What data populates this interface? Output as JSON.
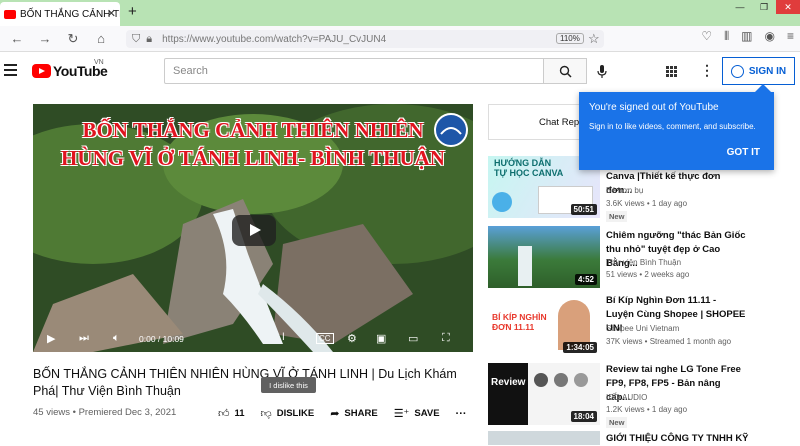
{
  "browser": {
    "tab_title": "BỐN THẮNG CẢNH THIÊN NHIÊN HÙNG VĨ Ở TÁNH LINH",
    "url": "https://www.youtube.com/watch?v=PAJU_CvJUN4",
    "zoom": "110%"
  },
  "header": {
    "logo_text": "YouTube",
    "region": "VN",
    "search_placeholder": "Search",
    "signin_label": "SIGN IN"
  },
  "popup": {
    "title": "You're signed out of YouTube",
    "body": "Sign in to like videos, comment, and subscribe.",
    "button": "GOT IT"
  },
  "player": {
    "overlay_line1": "BỐN THẮNG CẢNH THIÊN NHIÊN",
    "overlay_line2": "HÙNG VĨ Ở TÁNH LINH- BÌNH THUẬN",
    "time": "0:00 / 10:09",
    "progress": 0
  },
  "video": {
    "title": "BỐN THẮNG CẢNH THIÊN NHIÊN HÙNG VĨ Ở TÁNH LINH | Du Lịch Khám Phá| Thư Viện Bình Thuận",
    "views": "45 views",
    "date": "Premiered Dec 3, 2021",
    "likes": "11",
    "dislike_label": "DISLIKE",
    "share_label": "SHARE",
    "save_label": "SAVE",
    "tooltip": "I dislike this"
  },
  "sidebar": {
    "chat_replay": "Chat Replay",
    "items": [
      {
        "title": "Canva |Thiết kế thực đơn đơn...",
        "channel": "Bé bơn bụ",
        "stats": "3.6K views • 1 day ago",
        "badge": "New",
        "duration": "50:51",
        "thumb_text": "HƯỚNG DẪN TỰ HỌC CANVA"
      },
      {
        "title": "Chiêm ngưỡng \"thác Bản Giốc thu nhỏ\" tuyệt đẹp ở Cao Bằng...",
        "channel": "Thư viện Bình Thuận",
        "stats": "51 views • 2 weeks ago",
        "badge": "",
        "duration": "4:52",
        "thumb_text": ""
      },
      {
        "title": "Bí Kíp Nghìn Đơn 11.11 - Luyện Cùng Shopee | SHOPEE UNI",
        "channel": "Shopee Uni Vietnam",
        "stats": "37K views • Streamed 1 month ago",
        "badge": "",
        "duration": "1:34:05",
        "thumb_text": "BÍ KÍP NGHÌN ĐƠN 11.11"
      },
      {
        "title": "Review tai nghe LG Tone Free FP9, FP8, FP5 - Bản nâng cấp...",
        "channel": "IDO AUDIO",
        "stats": "1.2K views • 1 day ago",
        "badge": "New",
        "duration": "18:04",
        "thumb_text": "Review"
      },
      {
        "title": "GIỚI THIỆU CÔNG TY TNHH KỸ",
        "channel": "",
        "stats": "",
        "badge": "",
        "duration": "",
        "thumb_text": ""
      }
    ]
  }
}
